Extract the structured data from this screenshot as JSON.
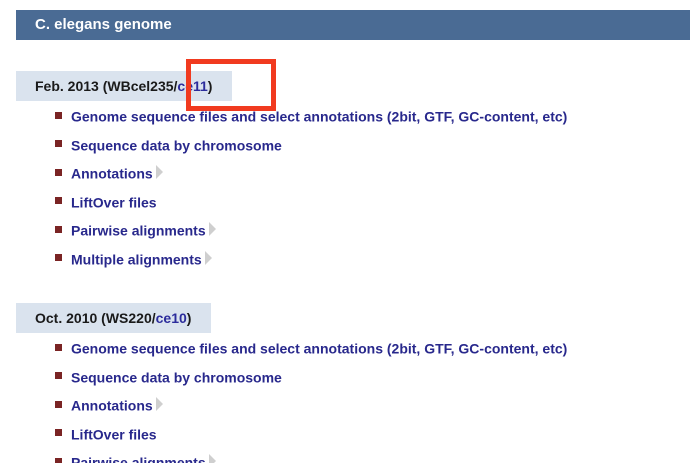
{
  "banner": {
    "title": "C. elegans genome"
  },
  "assemblies": [
    {
      "prefix": "Feb. 2013 (WBcel235/",
      "link": "ce11",
      "suffix": ")",
      "items": [
        {
          "label": "Genome sequence files and select annotations (2bit, GTF, GC-content, etc)",
          "expandable": false
        },
        {
          "label": "Sequence data by chromosome",
          "expandable": false
        },
        {
          "label": "Annotations",
          "expandable": true
        },
        {
          "label": "LiftOver files",
          "expandable": false
        },
        {
          "label": "Pairwise alignments",
          "expandable": true
        },
        {
          "label": "Multiple alignments",
          "expandable": true
        }
      ]
    },
    {
      "prefix": "Oct. 2010 (WS220/",
      "link": "ce10",
      "suffix": ")",
      "items": [
        {
          "label": "Genome sequence files and select annotations (2bit, GTF, GC-content, etc)",
          "expandable": false
        },
        {
          "label": "Sequence data by chromosome",
          "expandable": false
        },
        {
          "label": "Annotations",
          "expandable": true
        },
        {
          "label": "LiftOver files",
          "expandable": false
        },
        {
          "label": "Pairwise alignments",
          "expandable": true
        }
      ]
    }
  ],
  "colors": {
    "banner_bg": "#4a6b94",
    "header_bg": "#dae3ee",
    "link": "#28288c",
    "bullet": "#7a2424",
    "highlight": "#f13a1f"
  }
}
